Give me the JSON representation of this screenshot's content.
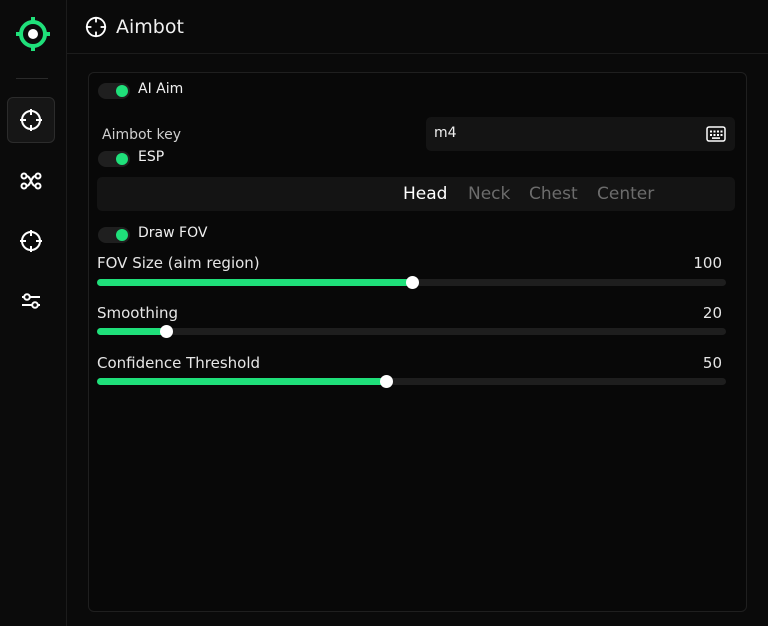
{
  "app": {
    "title": "Aimbot",
    "accent_color": "#1fe07a",
    "logo_icon": "crosshair-logo-icon"
  },
  "sidebar": {
    "items": [
      {
        "name": "aimbot",
        "icon": "crosshair-icon",
        "active": true
      },
      {
        "name": "network",
        "icon": "nodes-icon",
        "active": false
      },
      {
        "name": "target",
        "icon": "crosshair-icon",
        "active": false
      },
      {
        "name": "settings",
        "icon": "sliders-icon",
        "active": false
      }
    ]
  },
  "settings": {
    "ai_aim": {
      "label": "AI Aim",
      "enabled": true
    },
    "aimbot_key": {
      "label": "Aimbot key",
      "value": "m4",
      "icon": "keyboard-icon"
    },
    "esp": {
      "label": "ESP",
      "enabled": true
    },
    "target_part": {
      "options": [
        "Head",
        "Neck",
        "Chest",
        "Center"
      ],
      "selected": "Head"
    },
    "draw_fov": {
      "label": "Draw FOV",
      "enabled": true
    },
    "sliders": [
      {
        "label": "FOV Size (aim region)",
        "value": "100",
        "fill_fraction": 0.5
      },
      {
        "label": "Smoothing",
        "value": "20",
        "fill_fraction": 0.11
      },
      {
        "label": "Confidence Threshold",
        "value": "50",
        "fill_fraction": 0.46
      }
    ]
  }
}
